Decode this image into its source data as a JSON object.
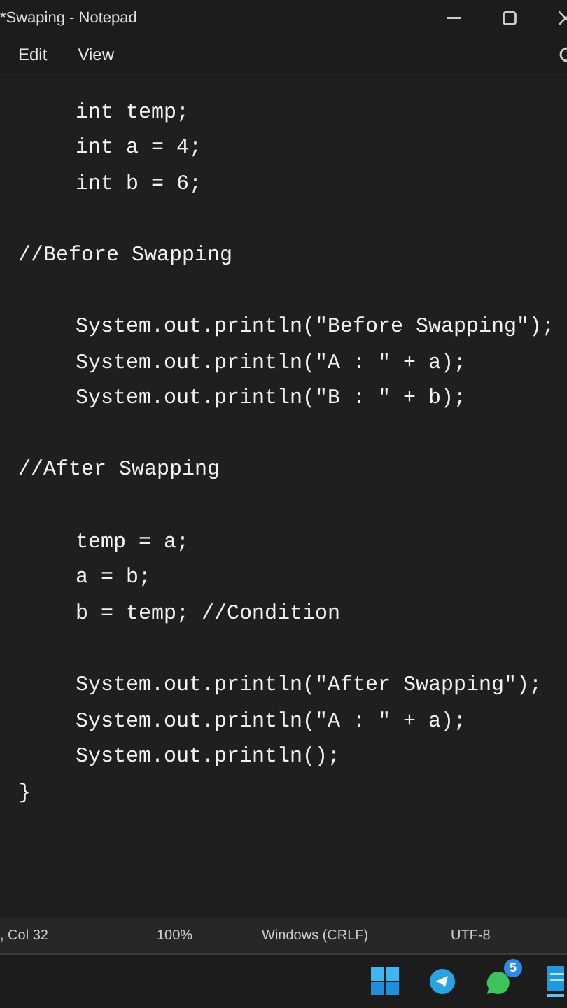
{
  "window": {
    "title": "*Swaping - Notepad"
  },
  "menu": [
    "Edit",
    "View"
  ],
  "editor": {
    "lines": [
      {
        "kind": "indented",
        "text": "int temp;"
      },
      {
        "kind": "indented",
        "text": "int a = 4;"
      },
      {
        "kind": "indented",
        "text": "int b = 6;"
      },
      {
        "kind": "blank"
      },
      {
        "kind": "plain",
        "text": "//Before Swapping"
      },
      {
        "kind": "blank"
      },
      {
        "kind": "indented",
        "text": "System.out.println(\"Before Swapping\");"
      },
      {
        "kind": "indented",
        "text": "System.out.println(\"A : \" + a);"
      },
      {
        "kind": "indented",
        "text": "System.out.println(\"B : \" + b);"
      },
      {
        "kind": "blank"
      },
      {
        "kind": "plain",
        "text": "//After Swapping"
      },
      {
        "kind": "blank"
      },
      {
        "kind": "indented",
        "text": "temp = a;"
      },
      {
        "kind": "indented",
        "text": "a = b;"
      },
      {
        "kind": "indented",
        "text": "b = temp; //Condition"
      },
      {
        "kind": "blank"
      },
      {
        "kind": "indented",
        "text": "System.out.println(\"After Swapping\");"
      },
      {
        "kind": "indented",
        "text": "System.out.println(\"A : \" + a);"
      },
      {
        "kind": "indented",
        "text": "System.out.println();"
      },
      {
        "kind": "plain",
        "text": "}"
      }
    ]
  },
  "status_bar": {
    "position": ", Col 32",
    "zoom": "100%",
    "line_ending": "Windows (CRLF)",
    "encoding": "UTF-8"
  },
  "taskbar": {
    "whatsapp_badge": "5"
  }
}
